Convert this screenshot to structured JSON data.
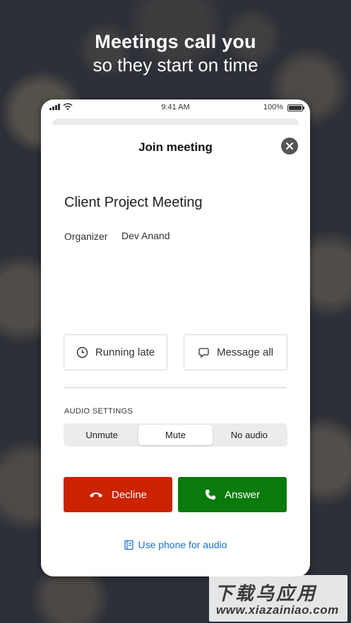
{
  "promo": {
    "line1": "Meetings call you",
    "line2": "so they start on time"
  },
  "status_bar": {
    "time": "9:41 AM",
    "battery": "100%"
  },
  "dialog": {
    "title": "Join meeting",
    "meeting_name": "Client Project Meeting",
    "organizer_label": "Organizer",
    "organizer_value": "Dev Anand",
    "actions": {
      "running_late": "Running late",
      "message_all": "Message all"
    },
    "audio_settings_label": "AUDIO SETTINGS",
    "audio_options": [
      "Unmute",
      "Mute",
      "No audio"
    ],
    "selected_audio_option": "Mute",
    "decline_label": "Decline",
    "answer_label": "Answer",
    "phone_audio_link": "Use phone for audio"
  },
  "watermark": {
    "line1": "下载乌应用",
    "line2": "www.xiazainiao.com"
  },
  "colors": {
    "decline": "#cc2200",
    "answer": "#0a7a0a",
    "link": "#1a6fd6",
    "close_button": "#555555"
  },
  "icons": {
    "close": "close-icon",
    "running_late": "clock-icon",
    "message_all": "chat-bubble-icon",
    "decline": "phone-hangup-icon",
    "answer": "phone-icon",
    "phone_audio": "phone-book-icon"
  }
}
